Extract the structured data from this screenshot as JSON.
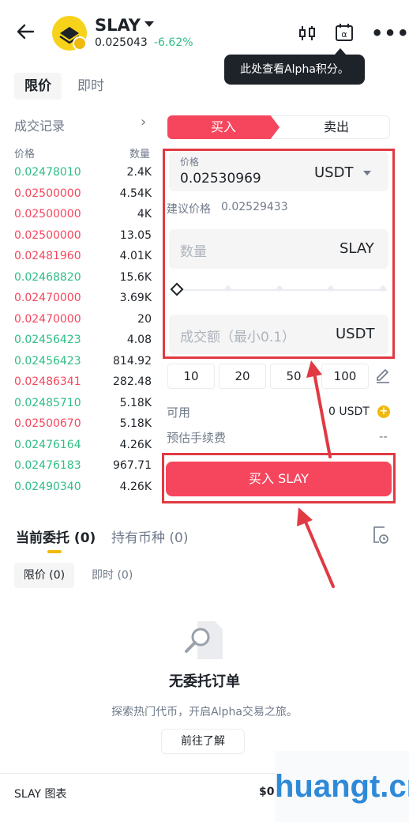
{
  "header": {
    "pair": "SLAY",
    "last_price": "0.025043",
    "change": "-6.62%",
    "tooltip": "此处查看Alpha积分。"
  },
  "order_type_tabs": [
    "限价",
    "即时"
  ],
  "trades": {
    "title": "成交记录",
    "col_price": "价格",
    "col_qty": "数量",
    "rows": [
      {
        "price": "0.02478010",
        "qty": "2.4K",
        "side": "green"
      },
      {
        "price": "0.02500000",
        "qty": "4.54K",
        "side": "red"
      },
      {
        "price": "0.02500000",
        "qty": "4K",
        "side": "red"
      },
      {
        "price": "0.02500000",
        "qty": "13.05",
        "side": "red"
      },
      {
        "price": "0.02481960",
        "qty": "4.01K",
        "side": "red"
      },
      {
        "price": "0.02468820",
        "qty": "15.6K",
        "side": "green"
      },
      {
        "price": "0.02470000",
        "qty": "3.69K",
        "side": "red"
      },
      {
        "price": "0.02470000",
        "qty": "20",
        "side": "red"
      },
      {
        "price": "0.02456423",
        "qty": "4.08",
        "side": "green"
      },
      {
        "price": "0.02456423",
        "qty": "814.92",
        "side": "green"
      },
      {
        "price": "0.02486341",
        "qty": "282.48",
        "side": "red"
      },
      {
        "price": "0.02485710",
        "qty": "5.18K",
        "side": "green"
      },
      {
        "price": "0.02500670",
        "qty": "5.18K",
        "side": "red"
      },
      {
        "price": "0.02476164",
        "qty": "4.26K",
        "side": "green"
      },
      {
        "price": "0.02476183",
        "qty": "967.71",
        "side": "green"
      },
      {
        "price": "0.02490340",
        "qty": "4.26K",
        "side": "green"
      }
    ]
  },
  "form": {
    "buy_label": "买入",
    "sell_label": "卖出",
    "price_label": "价格",
    "price_value": "0.02530969",
    "price_unit": "USDT",
    "suggest_label": "建议价格",
    "suggest_value": "0.02529433",
    "qty_placeholder": "数量",
    "qty_unit": "SLAY",
    "slider_percent": 0,
    "total_placeholder": "成交额（最小0.1）",
    "total_unit": "USDT",
    "quick_amounts": [
      "10",
      "20",
      "50",
      "100"
    ],
    "available_label": "可用",
    "available_value": "0 USDT",
    "fee_label": "预估手续费",
    "fee_value": "--",
    "submit_label": "买入 SLAY"
  },
  "orders": {
    "tab_open": "当前委托 (0)",
    "tab_holdings": "持有币种 (0)",
    "sub_limit": "限价 (0)",
    "sub_market": "即时 (0)",
    "empty_title": "无委托订单",
    "empty_desc": "探索热门代币，开启Alpha交易之旅。",
    "go_button": "前往了解"
  },
  "footer": {
    "chart_label": "SLAY 图表",
    "price": "$0"
  },
  "watermark": "huangt.cn",
  "colors": {
    "up": "#2ebd85",
    "down": "#f6465d",
    "accent": "#f0b90b",
    "annotation": "#e03a43"
  }
}
